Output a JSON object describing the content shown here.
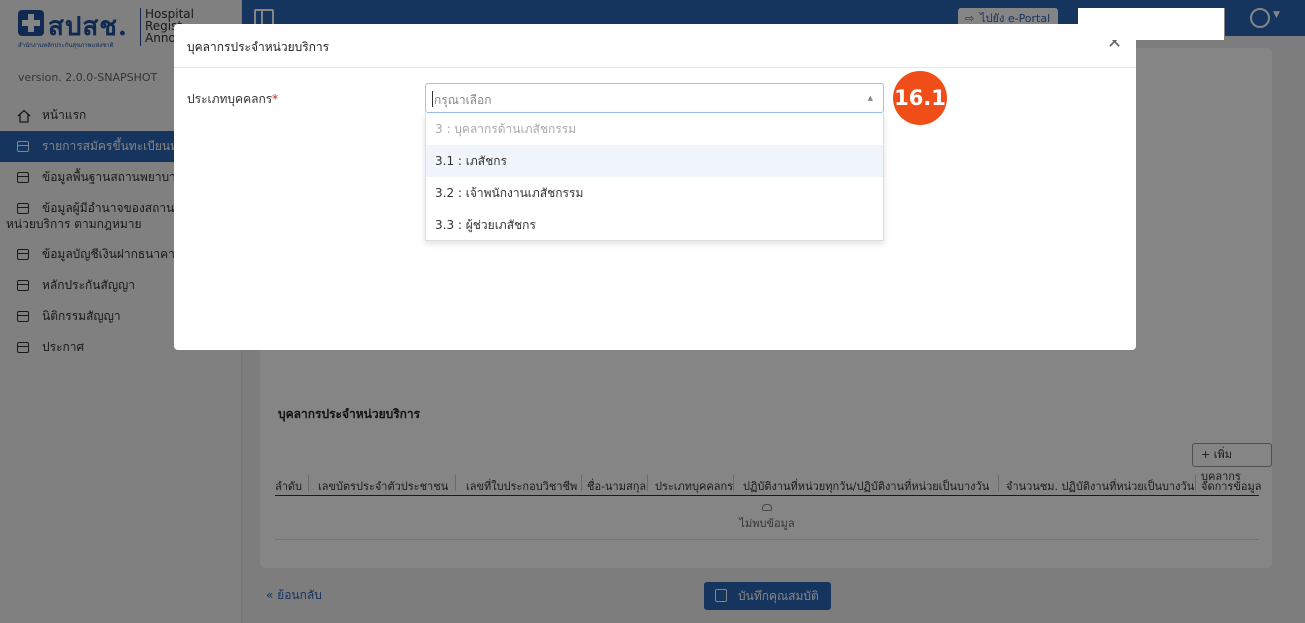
{
  "sidebar": {
    "logo_text": "สปสช.",
    "logo_subtext": "สำนักงานหลักประกันสุขภาพแห่งชาติ",
    "app_title_lines": [
      "Hospital",
      "Regist",
      "Annou"
    ],
    "version": "version. 2.0.0-SNAPSHOT",
    "items": [
      {
        "label": "หน้าแรก"
      },
      {
        "label": "รายการสมัครขึ้นทะเบียนหน่วยบริการ"
      },
      {
        "label": "ข้อมูลพื้นฐานสถานพยาบาล"
      },
      {
        "label": "ข้อมูลผู้มีอำนาจของสถานบริการ หน่วยบริการ ตามกฎหมาย"
      },
      {
        "label": "ข้อมูลบัญชีเงินฝากธนาคาร"
      },
      {
        "label": "หลักประกันสัญญา"
      },
      {
        "label": "นิติกรรมสัญญา"
      },
      {
        "label": "ประกาศ"
      }
    ]
  },
  "topbar": {
    "portal_label": "ไปยัง e-Portal"
  },
  "main": {
    "section_title": "บุคลากรประจำหน่วยบริการ",
    "add_button": "+ เพิ่มบุคลากร",
    "table_headers": [
      "ลำดับ",
      "เลขบัตรประจำตัวประชาชน",
      "เลขที่ใบประกอบวิชาชีพ",
      "ชื่อ-นามสกุล",
      "ประเภทบุคคลกร",
      "ปฏิบัติงานที่หน่วยทุกวัน/ปฏิบัติงานที่หน่วยเป็นบางวัน",
      "จำนวนชม. ปฏิบัติงานที่หน่วยเป็นบางวัน",
      "จัดการข้อมูล"
    ],
    "empty_text": "ไม่พบข้อมูล",
    "back_label": "ย้อนกลับ",
    "save_label": "บันทึกคุณสมบัติ"
  },
  "modal": {
    "title": "บุคลากรประจำหน่วยบริการ",
    "field_label": "ประเภทบุคคลกร",
    "required_mark": "*",
    "select_placeholder": "กรุณาเลือก",
    "options": [
      {
        "label": "3 : บุคลากรด้านเภสัชกรรม",
        "group": true
      },
      {
        "label": "3.1 : เภสัชกร"
      },
      {
        "label": "3.2 : เจ้าพนักงานเภสัชกรรม"
      },
      {
        "label": "3.3 : ผู้ช่วยเภสัชกร"
      }
    ]
  },
  "annotation": {
    "badge": "16.1"
  },
  "colors": {
    "primary": "#2a64b5",
    "badge": "#f04e18",
    "required": "#e02020"
  }
}
